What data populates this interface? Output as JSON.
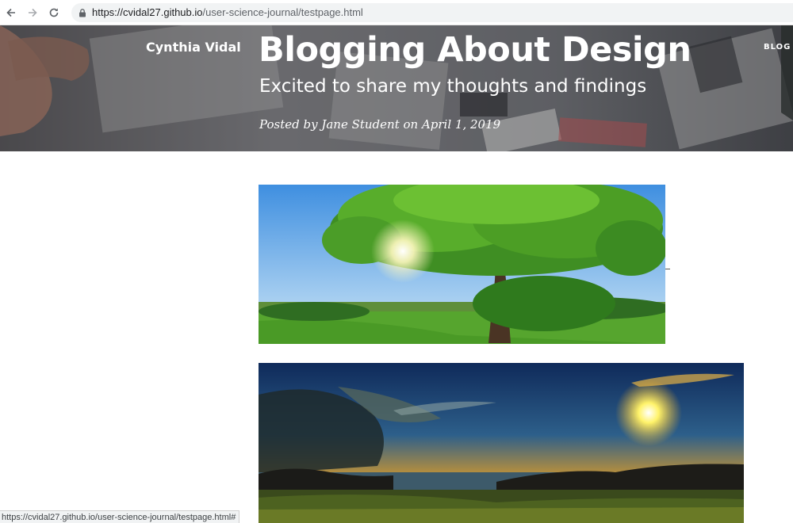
{
  "browser": {
    "icons": {
      "back": "arrow-left-icon",
      "forward": "arrow-right-icon",
      "reload": "reload-icon",
      "secure": "lock-icon"
    },
    "url": {
      "prefix": "https://",
      "host": "cvidal27.github.io",
      "path": "/user-science-journal/testpage.html"
    },
    "status_url": "https://cvidal27.github.io/user-science-journal/testpage.html#"
  },
  "header": {
    "site_name": "Cynthia Vidal",
    "nav_blog": "BLOG",
    "title": "Blogging About Design",
    "subtitle": "Excited to share my thoughts and findings",
    "meta": "Posted by Jane Student on April 1, 2019"
  },
  "content": {
    "images": [
      {
        "name": "tree-meadow-photo"
      },
      {
        "name": "sunset-coast-photo"
      }
    ]
  },
  "colors": {
    "link_text": "#202124",
    "url_path": "#5f6368",
    "header_text": "#ffffff"
  }
}
